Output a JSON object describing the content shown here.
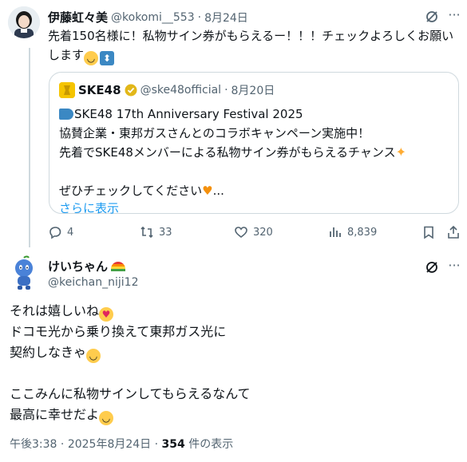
{
  "tweet1": {
    "display_name": "伊藤虹々美",
    "handle": "@kokomi__553",
    "dot": "·",
    "date": "8月24日",
    "text_line1": "先着150名様に！私物サイン券がもらえるー！！！チェックよろしくお願い",
    "text_line2": "します",
    "quote": {
      "display_name": "SKE48",
      "handle": "@ske48official",
      "dot": "·",
      "date": "8月20日",
      "line1": "SKE48 17th Anniversary Festival 2025",
      "line2": "協賛企業・東邦ガスさんとのコラボキャンペーン実施中！",
      "line3": "先着でSKE48メンバーによる私物サイン券がもらえるチャンス",
      "line4": "ぜひチェックしてください",
      "ellipsis": "...",
      "show_more": "さらに表示"
    },
    "actions": {
      "replies": "4",
      "retweets": "33",
      "likes": "320",
      "views": "8,839"
    }
  },
  "tweet2": {
    "display_name": "けいちゃん",
    "handle": "@keichan_niji12",
    "text_line1": "それは嬉しいね",
    "text_line2": "ドコモ光から乗り換えて東邦ガス光に",
    "text_line3": "契約しなきゃ",
    "text_line4": "ここみんに私物サインしてもらえるなんて",
    "text_line5": "最高に幸せだよ",
    "footer_time": "午後3:38",
    "footer_dot1": "·",
    "footer_date": "2025年8月24日",
    "footer_dot2": "·",
    "footer_views_count": "354",
    "footer_views_label": " 件の表示"
  },
  "colors": {
    "accent": "#1d9bf0",
    "muted": "#536471",
    "border": "#cfd9de",
    "verified_gold": "#e2b719"
  }
}
